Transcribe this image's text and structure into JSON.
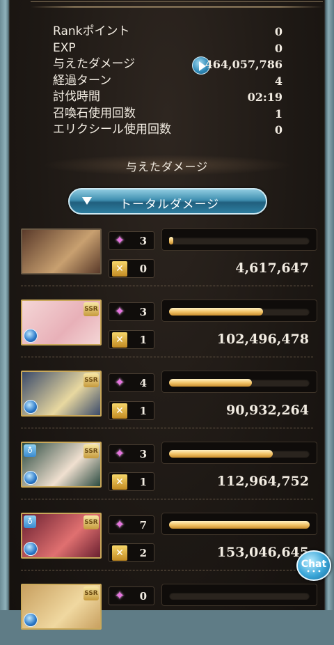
{
  "stats": [
    {
      "label": "Rankポイント",
      "value": "0"
    },
    {
      "label": "EXP",
      "value": "0"
    },
    {
      "label": "与えたダメージ",
      "value": "464,057,786"
    },
    {
      "label": "経過ターン",
      "value": "4"
    },
    {
      "label": "討伐時間",
      "value": "02:19"
    },
    {
      "label": "召喚石使用回数",
      "value": "1"
    },
    {
      "label": "エリクシール使用回数",
      "value": "0"
    }
  ],
  "section_title": "与えたダメージ",
  "dropdown": {
    "label": "トータルダメージ"
  },
  "characters": [
    {
      "star_count": "3",
      "ougi_count": "0",
      "damage": "4,617,647",
      "bar_ratio": 0.03,
      "ssr": "",
      "portrait_colors": [
        "#5a3a2a",
        "#c8a070"
      ]
    },
    {
      "star_count": "3",
      "ougi_count": "1",
      "damage": "102,496,478",
      "bar_ratio": 0.67,
      "ssr": "SSR",
      "portrait_colors": [
        "#f4d6d6",
        "#e8b0b8"
      ]
    },
    {
      "star_count": "4",
      "ougi_count": "1",
      "damage": "90,932,264",
      "bar_ratio": 0.59,
      "ssr": "SSR",
      "portrait_colors": [
        "#3a4a6a",
        "#e8d8a0"
      ]
    },
    {
      "star_count": "3",
      "ougi_count": "1",
      "damage": "112,964,752",
      "bar_ratio": 0.74,
      "ssr": "SSR",
      "portrait_colors": [
        "#2a4a40",
        "#f0e0d0"
      ]
    },
    {
      "star_count": "7",
      "ougi_count": "2",
      "damage": "153,046,645",
      "bar_ratio": 1.0,
      "ssr": "SSR",
      "portrait_colors": [
        "#6a2030",
        "#e07070"
      ]
    },
    {
      "star_count": "0",
      "ougi_count": "",
      "damage": "",
      "bar_ratio": 0.0,
      "ssr": "SSR",
      "portrait_colors": [
        "#c8a060",
        "#f0d8a0"
      ]
    }
  ],
  "chat": {
    "label": "Chat",
    "dots": "• • •"
  },
  "icons": {
    "play": "play-icon",
    "star": "star-icon",
    "ougi": "ougi-icon",
    "element": "water-element-icon"
  }
}
